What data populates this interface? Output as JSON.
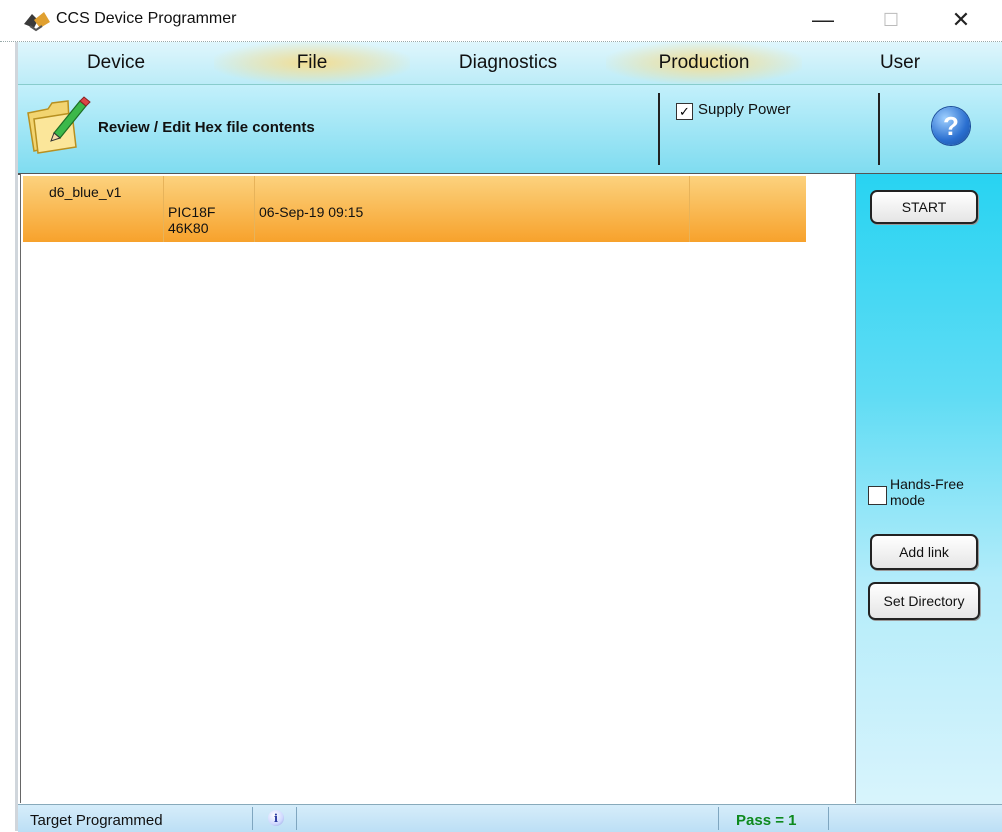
{
  "window": {
    "title": "CCS Device Programmer",
    "controls": {
      "minimize": "—",
      "maximize": "☐",
      "close": "✕"
    }
  },
  "menu": [
    "Device",
    "File",
    "Diagnostics",
    "Production",
    "User"
  ],
  "toolbar": {
    "action_label": "Review / Edit  Hex file contents",
    "supply_power": {
      "label": "Supply Power",
      "checked": true,
      "mark": "✓"
    },
    "help_glyph": "?"
  },
  "list": {
    "rows": [
      {
        "name": "d6_blue_v1",
        "device_line1": "PIC18F",
        "device_line2": "46K80",
        "date": "06-Sep-19 09:15",
        "extra": ""
      }
    ]
  },
  "side": {
    "start_label": "START",
    "hands_free": {
      "line1": "Hands-Free",
      "line2": "mode",
      "checked": false
    },
    "add_link_label": "Add link",
    "set_directory_label": "Set Directory"
  },
  "status": {
    "text": "Target Programmed",
    "info_glyph": "i",
    "pass": "Pass = 1"
  },
  "colors": {
    "menu_bg": "#bcecf8",
    "toolbar_bg": "#7fdcf0",
    "row_selected": "#f7a22c",
    "panel_bg": "#28d3f2",
    "pass_green": "#0e8a1e"
  }
}
